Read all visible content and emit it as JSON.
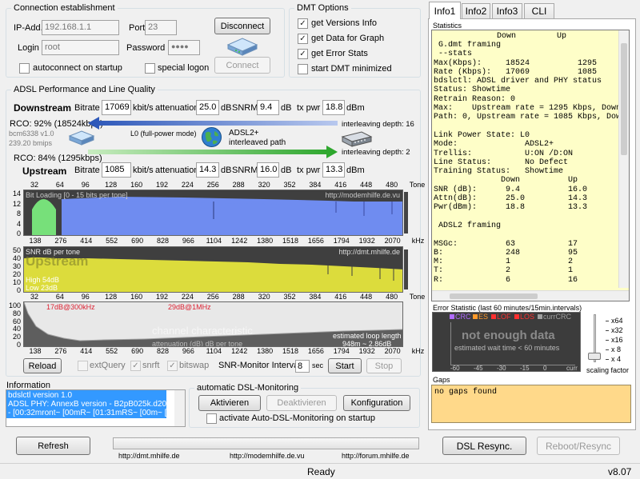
{
  "connection": {
    "title": "Connection establishment",
    "ip_label": "IP-Add.",
    "ip_value": "192.168.1.1",
    "port_label": "Port",
    "port_value": "23",
    "login_label": "Login",
    "login_value": "root",
    "password_label": "Password",
    "password_value": "●●●●",
    "disconnect": "Disconnect",
    "connect": "Connect",
    "autoconnect": "autoconnect on startup",
    "special_logon": "special logon"
  },
  "dmt_options": {
    "title": "DMT Options",
    "items": [
      {
        "label": "get Versions Info",
        "checked": true
      },
      {
        "label": "get Data for Graph",
        "checked": true
      },
      {
        "label": "get Error Stats",
        "checked": true
      },
      {
        "label": "start DMT minimized",
        "checked": false
      }
    ]
  },
  "adsl": {
    "title": "ADSL Performance and Line Quality",
    "downstream": {
      "label": "Downstream",
      "bitrate_label": "Bitrate",
      "bitrate": "17069",
      "bitrate_unit": "kbit/s",
      "atten_label": "attenuation",
      "atten": "25.0",
      "atten_unit": "dB",
      "snrm_label": "SNRM",
      "snrm": "9.4",
      "snrm_unit": "dB",
      "txpwr_label": "tx pwr",
      "txpwr": "18.8",
      "txpwr_unit": "dBm",
      "rco": "RCO: 92% (18524kbps)",
      "interleave": "interleaving depth: 16"
    },
    "upstream": {
      "label": "Upstream",
      "bitrate_label": "Bitrate",
      "bitrate": "1085",
      "bitrate_unit": "kbit/s",
      "atten_label": "attenuation",
      "atten": "14.3",
      "atten_unit": "dB",
      "snrm_label": "SNRM",
      "snrm": "16.0",
      "snrm_unit": "dB",
      "txpwr_label": "tx pwr",
      "txpwr": "13.3",
      "txpwr_unit": "dBm",
      "rco": "RCO: 84% (1295kbps)",
      "interleave": "interleaving depth: 2"
    },
    "modem_name": "bcm6338 v1.0",
    "modem_uptime": "239.20 bmips",
    "mode": "L0 (full-power mode)",
    "path1": "ADSL2+",
    "path2": "interleaved path"
  },
  "charts": {
    "tone_axis": [
      "32",
      "64",
      "96",
      "128",
      "160",
      "192",
      "224",
      "256",
      "288",
      "320",
      "352",
      "384",
      "416",
      "448",
      "480",
      "Tone"
    ],
    "khz_axis": [
      "138",
      "276",
      "414",
      "552",
      "690",
      "828",
      "966",
      "1104",
      "1242",
      "1380",
      "1518",
      "1656",
      "1794",
      "1932",
      "2070",
      "kHz"
    ],
    "bitload": {
      "title": "Bit Loading [0 - 15 bits per tone]",
      "url": "http://modemhilfe.de.vu",
      "yticks": [
        "14",
        "12",
        "8",
        "4",
        "0"
      ]
    },
    "snr": {
      "title": "SNR  dB per tone",
      "watermark": "Upstream",
      "url": "http://dmt.mhilfe.de",
      "high": "High 54dB",
      "low": "Low  23dB",
      "yticks": [
        "50",
        "40",
        "30",
        "20",
        "10",
        "0"
      ]
    },
    "channel": {
      "ann1": "17dB@300kHz",
      "ann2": "29dB@1MHz",
      "watermark": "channel characteristic",
      "loop_len": "estimated loop length",
      "loop_val": "948m ~ 2.86dB",
      "atten_note": "attenuation (dB) dB per tone",
      "yticks": [
        "100",
        "80",
        "60",
        "40",
        "20",
        "0"
      ]
    }
  },
  "controls": {
    "reload": "Reload",
    "extquery": "extQuery",
    "snrft": "snrft",
    "bitswap": "bitswap",
    "snr_interval_label": "SNR-Monitor Interval:",
    "snr_interval": "8",
    "sec": "sec",
    "start": "Start",
    "stop": "Stop"
  },
  "information": {
    "title": "Information",
    "lines": [
      "bdslctl version 1.0",
      "ADSL PHY: AnnexB version - B2pB025k.d20k_r",
      "- [00:32mront~ [00mR~ [01:31mRS~ [00m~ [01:"
    ]
  },
  "monitoring": {
    "title": "automatic DSL-Monitoring",
    "activate": "Aktivieren",
    "deactivate": "Deaktivieren",
    "config": "Konfiguration",
    "auto_label": "activate Auto-DSL-Monitoring on startup"
  },
  "tabs": [
    "Info1",
    "Info2",
    "Info3",
    "CLI"
  ],
  "stats": {
    "title": "Statistics",
    "text": " G.dmt framing\n --stats\nMax(Kbps):     18524          1295\nRate (Kbps):   17069          1085\nbdslctl: ADSL driver and PHY status\nStatus: Showtime\nRetrain Reason: 0\nMax:    Upstream rate = 1295 Kbps, Downstream r\nPath: 0, Upstream rate = 1085 Kbps, Downstream\n\nLink Power State: L0\nMode:              ADSL2+\nTrellis:           U:ON /D:ON\nLine Status:       No Defect\nTraining Status:   Showtime\n              Down          Up\nSNR (dB):      9.4          16.0\nAttn(dB):      25.0         14.3\nPwr(dBm):      18.8         13.3\n\n ADSL2 framing\n\nMSGc:          63           17\nB:             248          95\nM:             1            2\nT:             2            1\nR:             6            16",
    "col_down": "Down",
    "col_up": "Up"
  },
  "errstat": {
    "title": "Error Statistic (last 60 minutes/15min.intervals)",
    "legend": [
      "CRC",
      "ES",
      "LOF",
      "LOS",
      "currCRC"
    ],
    "legend_colors": [
      "#b06aff",
      "#ff9a2a",
      "#ff3030",
      "#ff3030",
      "#a0a0a0"
    ],
    "msg": "not enough data",
    "wait": "estimated wait time < 60 minutes",
    "xticks": [
      "-60",
      "-45",
      "-30",
      "-15",
      "0",
      "curr"
    ],
    "scale": [
      "x64",
      "x32",
      "x16",
      "x 8",
      "x 4"
    ],
    "scale_label": "scaling factor"
  },
  "gaps": {
    "title": "Gaps",
    "text": "no gaps found"
  },
  "bottom": {
    "refresh": "Refresh",
    "url1": "http://dmt.mhilfe.de",
    "url2": "http://modemhilfe.de.vu",
    "url3": "http://forum.mhilfe.de",
    "resync": "DSL Resync.",
    "reboot": "Reboot/Resync"
  },
  "status": {
    "text": "Ready",
    "version": "v8.07"
  }
}
